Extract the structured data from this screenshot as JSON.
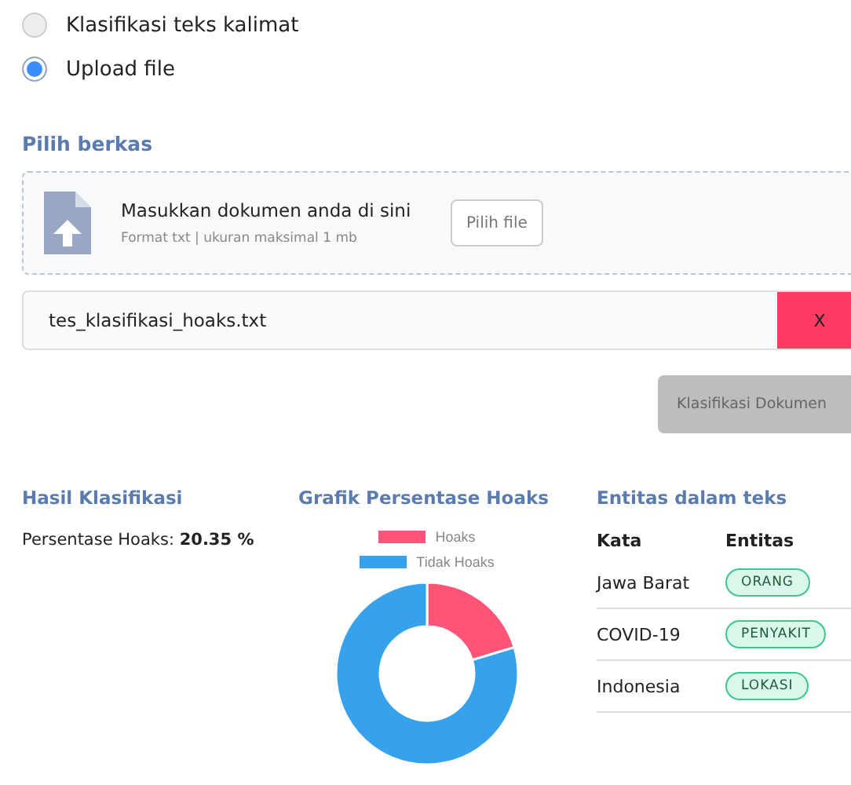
{
  "mode_options": [
    {
      "label": "Klasifikasi teks kalimat",
      "selected": false
    },
    {
      "label": "Upload file",
      "selected": true
    }
  ],
  "upload": {
    "heading": "Pilih berkas",
    "prompt": "Masukkan dokumen anda di sini",
    "hint": "Format txt | ukuran maksimal 1 mb",
    "browse_button": "Pilih file",
    "file_name": "tes_klasifikasi_hoaks.txt",
    "remove_button": "X",
    "submit_button": "Klasifikasi Dokumen"
  },
  "result": {
    "heading": "Hasil Klasifikasi",
    "label": "Persentase Hoaks:",
    "value": "20.35 %"
  },
  "chart": {
    "heading": "Grafik Persentase Hoaks",
    "chart_data": {
      "type": "donut",
      "categories": [
        "Hoaks",
        "Tidak Hoaks"
      ],
      "values": [
        20.35,
        79.65
      ],
      "colors": [
        "#ff5378",
        "#36a2eb"
      ],
      "legend": "top"
    }
  },
  "entities": {
    "heading": "Entitas dalam teks",
    "columns": [
      "Kata",
      "Entitas"
    ],
    "rows": [
      {
        "word": "Jawa Barat",
        "entity": "ORANG"
      },
      {
        "word": "COVID-19",
        "entity": "PENYAKIT"
      },
      {
        "word": "Indonesia",
        "entity": "LOKASI"
      }
    ]
  }
}
